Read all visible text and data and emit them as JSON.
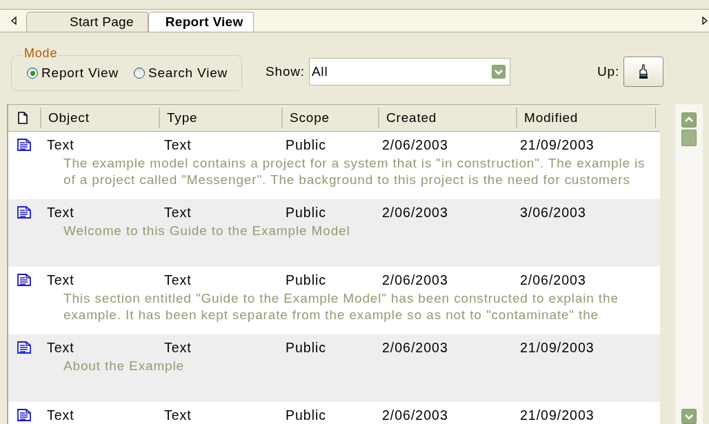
{
  "tabs": [
    {
      "label": "Start Page",
      "selected": false
    },
    {
      "label": "Report View",
      "selected": true
    }
  ],
  "mode": {
    "legend": "Mode",
    "options": [
      {
        "label": "Report View",
        "selected": true
      },
      {
        "label": "Search View",
        "selected": false
      }
    ]
  },
  "show": {
    "label": "Show:",
    "value": "All"
  },
  "up": {
    "label": "Up:"
  },
  "table": {
    "columns": [
      "Object",
      "Type",
      "Scope",
      "Created",
      "Modified"
    ],
    "rows": [
      {
        "cells": [
          "Text",
          "Text",
          "Public",
          "2/06/2003",
          "21/09/2003"
        ],
        "description": [
          "The example model contains a project for a system that is \"in construction\". The example is",
          "of a project called \"Messenger\". The background to this project is the need for customers"
        ]
      },
      {
        "cells": [
          "Text",
          "Text",
          "Public",
          "2/06/2003",
          "3/06/2003"
        ],
        "description": [
          "Welcome to this Guide to the Example Model"
        ]
      },
      {
        "cells": [
          "Text",
          "Text",
          "Public",
          "2/06/2003",
          "2/06/2003"
        ],
        "description": [
          "This section entitled \"Guide to the Example Model\" has been constructed to explain the",
          "example. It has been kept separate from the example so as not to \"contaminate\" the"
        ]
      },
      {
        "cells": [
          "Text",
          "Text",
          "Public",
          "2/06/2003",
          "21/09/2003"
        ],
        "description": [
          "About the Example"
        ]
      },
      {
        "cells": [
          "Text",
          "Text",
          "Public",
          "2/06/2003",
          "21/09/2003"
        ]
      }
    ]
  }
}
